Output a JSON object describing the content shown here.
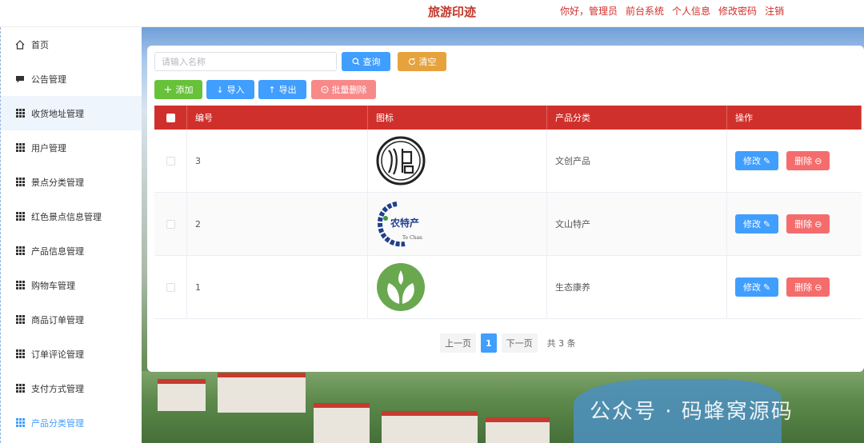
{
  "header": {
    "title": "旅游印迹",
    "greeting": "你好，管理员",
    "front": "前台系统",
    "profile": "个人信息",
    "password": "修改密码",
    "logout": "注销"
  },
  "sidebar": {
    "items": [
      {
        "label": "首页",
        "icon": "home-icon"
      },
      {
        "label": "公告管理",
        "icon": "message-icon"
      },
      {
        "label": "收货地址管理",
        "icon": "grid-icon"
      },
      {
        "label": "用户管理",
        "icon": "grid-icon"
      },
      {
        "label": "景点分类管理",
        "icon": "grid-icon"
      },
      {
        "label": "红色景点信息管理",
        "icon": "grid-icon"
      },
      {
        "label": "产品信息管理",
        "icon": "grid-icon"
      },
      {
        "label": "购物车管理",
        "icon": "grid-icon"
      },
      {
        "label": "商品订单管理",
        "icon": "grid-icon"
      },
      {
        "label": "订单评论管理",
        "icon": "grid-icon"
      },
      {
        "label": "支付方式管理",
        "icon": "grid-icon"
      },
      {
        "label": "产品分类管理",
        "icon": "grid-icon"
      }
    ]
  },
  "search": {
    "placeholder": "请输入名称",
    "query_label": "查询",
    "clear_label": "清空"
  },
  "toolbar": {
    "add_label": "添加",
    "import_label": "导入",
    "export_label": "导出",
    "batch_delete_label": "批量删除"
  },
  "table": {
    "columns": [
      "编号",
      "图标",
      "产品分类",
      "操作"
    ],
    "rows": [
      {
        "id": "3",
        "icon": "seal-logo",
        "category": "文创产品"
      },
      {
        "id": "2",
        "icon": "tc-specialty-logo",
        "category": "文山特产"
      },
      {
        "id": "1",
        "icon": "leaf-logo",
        "category": "生态康养"
      }
    ],
    "edit_label": "修改",
    "delete_label": "删除"
  },
  "pagination": {
    "prev": "上一页",
    "current": "1",
    "next": "下一页",
    "total": "共 3 条"
  },
  "watermark": "公众号 · 码蜂窝源码",
  "logo_text": {
    "tc_cn": "农特产",
    "tc_en": "Te Chan"
  },
  "colors": {
    "brand_red": "#d0302c",
    "primary": "#409eff",
    "danger": "#f56c6c",
    "success": "#67c23a",
    "warning": "#e6a23c"
  }
}
